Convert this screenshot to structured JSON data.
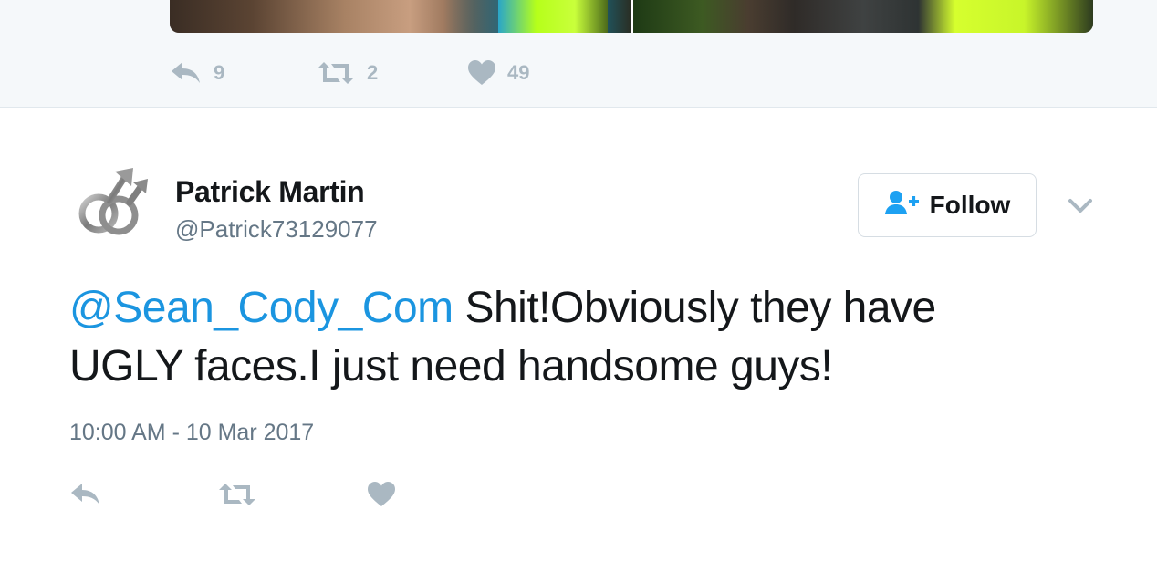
{
  "previous_tweet": {
    "actions": {
      "reply_count": "9",
      "retweet_count": "2",
      "like_count": "49"
    }
  },
  "tweet": {
    "author": {
      "name": "Patrick Martin",
      "handle": "@Patrick73129077",
      "avatar_icon": "mars-double-symbol-icon"
    },
    "follow_button": {
      "label": "Follow",
      "icon": "follow-user-icon"
    },
    "menu_icon": "chevron-down-icon",
    "text": {
      "mention": "@Sean_Cody_Com",
      "body_line1": " Shit!Obviously they have",
      "body_line2": "UGLY faces.I just need handsome guys!"
    },
    "timestamp": "10:00 AM - 10 Mar 2017",
    "actions": [
      "reply-icon",
      "retweet-icon",
      "like-icon"
    ]
  },
  "colors": {
    "link": "#1b95e0",
    "text": "#14171a",
    "muted": "#657786",
    "icon": "#aab8c2",
    "background_alt": "#f5f8fa"
  }
}
